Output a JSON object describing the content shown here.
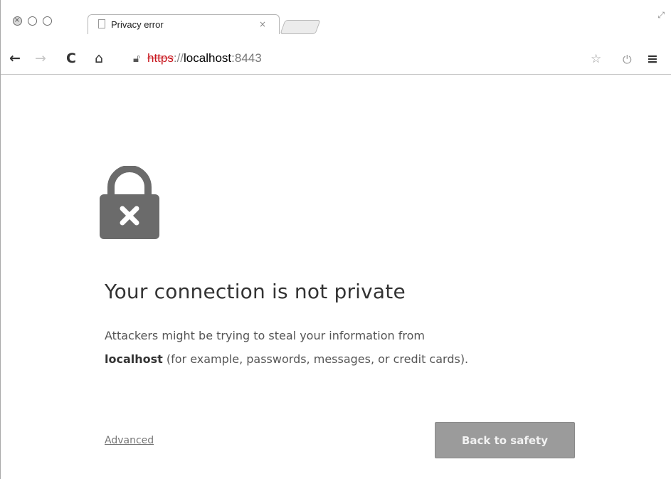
{
  "browser": {
    "tab": {
      "title": "Privacy error",
      "close_glyph": "×"
    },
    "omnibox": {
      "scheme": "https",
      "separator": "://",
      "host": "localhost",
      "port": ":8443",
      "security_state": "broken-lock-icon"
    },
    "toolbar_icons": [
      "back-icon",
      "forward-icon",
      "reload-icon",
      "home-icon",
      "star-icon",
      "power-icon",
      "menu-icon"
    ]
  },
  "page": {
    "heading": "Your connection is not private",
    "message": {
      "line1": "Attackers might be trying to steal your information from",
      "host": "localhost",
      "line2_rest": "(for example, passwords, messages, or credit cards)."
    },
    "advanced_link": "Advanced",
    "back_button": "Back to safety"
  },
  "colors": {
    "lock_icon": "#6b6b6b",
    "error_scheme": "#c8161d",
    "button_bg": "#9b9b9b"
  }
}
